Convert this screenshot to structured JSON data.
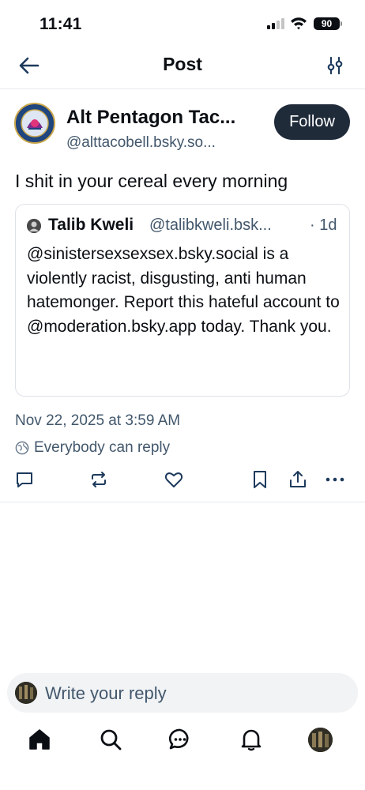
{
  "status_bar": {
    "time": "11:41",
    "battery": "90"
  },
  "header": {
    "title": "Post",
    "back_icon": "arrow-left-icon",
    "filter_icon": "sliders-icon"
  },
  "post": {
    "author_name": "Alt Pentagon Tac...",
    "author_handle": "@alttacobell.bsky.so...",
    "follow_label": "Follow",
    "text": "I shit in your cereal every morning",
    "date": "Nov 22, 2025 at 3:59 AM",
    "reply_setting": "Everybody can reply"
  },
  "quote": {
    "author_name": "Talib Kweli",
    "author_handle": "@talibkweli.bsk...",
    "time": "· 1d",
    "text": "@sinistersexsexsex.bsky.social is a violently racist, disgusting, anti human hatemonger. Report this hateful account to @moderation.bsky.app today. Thank you."
  },
  "actions": [
    "reply-icon",
    "repost-icon",
    "like-icon",
    "bookmark-icon",
    "share-icon",
    "more-icon"
  ],
  "composer": {
    "placeholder": "Write your reply"
  },
  "tabbar": [
    "home-icon",
    "search-icon",
    "chat-icon",
    "bell-icon",
    "profile-avatar"
  ],
  "colors": {
    "text": "#0b0f14",
    "muted": "#42576c",
    "follow_bg": "#202b3a",
    "divider": "#e6e9ee",
    "composer_bg": "#f1f3f5"
  }
}
